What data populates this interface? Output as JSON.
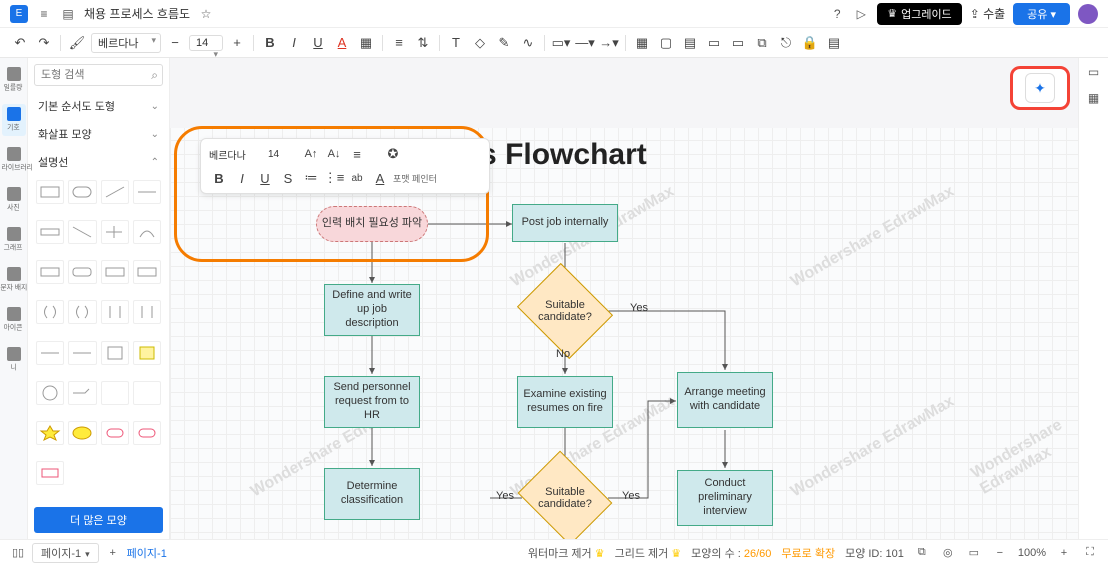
{
  "titlebar": {
    "doc_title": "채용 프로세스 흐름도",
    "upgrade": "업그레이드",
    "export": "수출",
    "share": "공유"
  },
  "toolbar": {
    "font": "베르다나",
    "font_size": "14"
  },
  "rail": {
    "items": [
      {
        "label": "일률량"
      },
      {
        "label": "기호"
      },
      {
        "label": "내 라이브러리"
      },
      {
        "label": "사진"
      },
      {
        "label": "그래프"
      },
      {
        "label": "문자 배지"
      },
      {
        "label": "아이콘"
      },
      {
        "label": "니"
      }
    ]
  },
  "sidebar": {
    "search_ph": "도형 검색",
    "categories": [
      {
        "label": "기본 순서도 도형",
        "open": false
      },
      {
        "label": "화살표 모양",
        "open": false
      },
      {
        "label": "설명선",
        "open": true
      }
    ],
    "more": "더 많은 모양"
  },
  "float_toolbar": {
    "font": "베르다나",
    "font_size": "14",
    "format_painter": "포맷 페인터"
  },
  "canvas": {
    "title": "rocess Flowchart",
    "nodes": {
      "start": "인력 배치 필요성 파악",
      "n1": "Define and write up job description",
      "n2": "Send personnel request from to HR",
      "n3": "Determine classification",
      "n4": "Post job internally",
      "d1": "Suitable candidate?",
      "n5": "Examine existing resumes on fire",
      "d2": "Suitable candidate?",
      "n6": "Arrange meeting with candidate",
      "n7": "Conduct preliminary interview"
    },
    "labels": {
      "yes": "Yes",
      "no": "No"
    }
  },
  "statusbar": {
    "page_sel": "페이지-1",
    "page_cur": "페이지-1",
    "watermark": "워터마크 제거",
    "grid": "그리드 제거",
    "shape_count_lbl": "모양의 수 :",
    "shape_count": "26/60",
    "free": "무료로 확장",
    "shape_id_lbl": "모양 ID:",
    "shape_id": "101",
    "zoom": "100%"
  },
  "watermark_text": "Wondershare EdrawMax"
}
